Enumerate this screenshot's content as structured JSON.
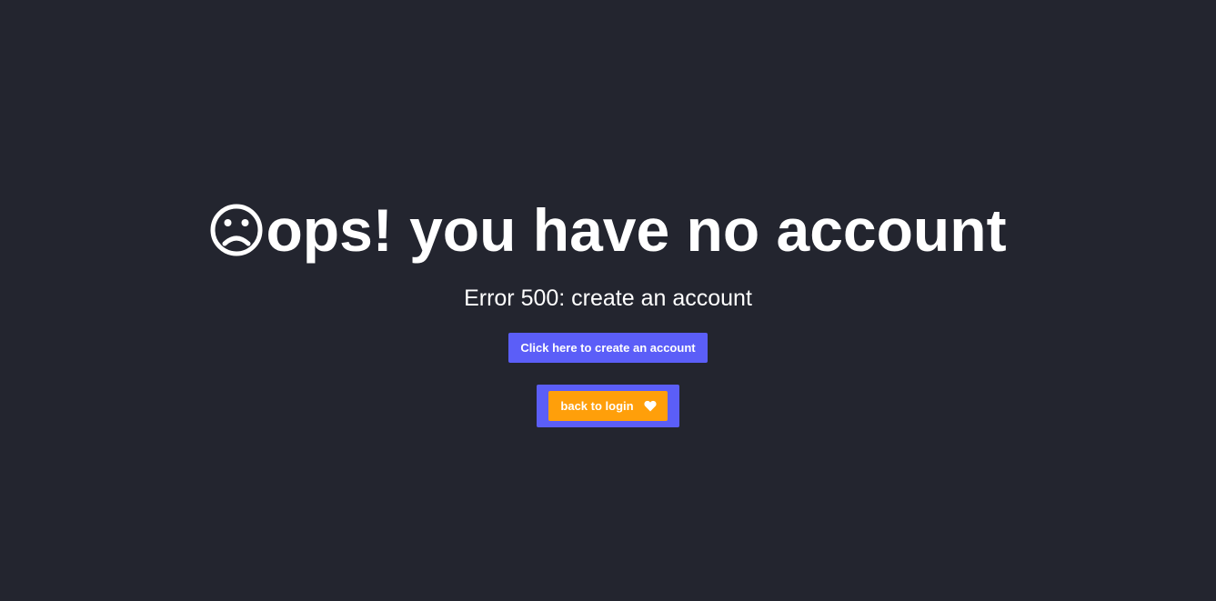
{
  "headline": {
    "icon": "sad-face-icon",
    "text": "ops! you have no account"
  },
  "subtitle": "Error 500: create an account",
  "create_button": {
    "label": "Click here to create an account",
    "color": "#5b5ef8"
  },
  "back_button": {
    "label": "back to login",
    "icon": "heart-icon",
    "color": "#ff9f0a",
    "frame_color": "#5b5ef8"
  },
  "colors": {
    "background": "#23252f",
    "text": "#ffffff"
  }
}
